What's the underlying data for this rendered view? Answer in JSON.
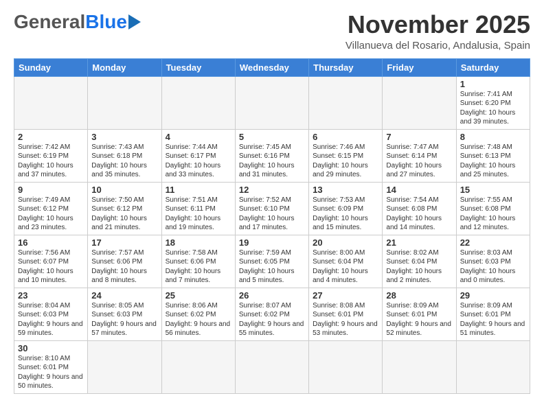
{
  "header": {
    "logo_general": "General",
    "logo_blue": "Blue",
    "month_title": "November 2025",
    "location": "Villanueva del Rosario, Andalusia, Spain"
  },
  "days_of_week": [
    "Sunday",
    "Monday",
    "Tuesday",
    "Wednesday",
    "Thursday",
    "Friday",
    "Saturday"
  ],
  "weeks": [
    [
      {
        "day": null,
        "info": null
      },
      {
        "day": null,
        "info": null
      },
      {
        "day": null,
        "info": null
      },
      {
        "day": null,
        "info": null
      },
      {
        "day": null,
        "info": null
      },
      {
        "day": null,
        "info": null
      },
      {
        "day": "1",
        "info": "Sunrise: 7:41 AM\nSunset: 6:20 PM\nDaylight: 10 hours and 39 minutes."
      }
    ],
    [
      {
        "day": "2",
        "info": "Sunrise: 7:42 AM\nSunset: 6:19 PM\nDaylight: 10 hours and 37 minutes."
      },
      {
        "day": "3",
        "info": "Sunrise: 7:43 AM\nSunset: 6:18 PM\nDaylight: 10 hours and 35 minutes."
      },
      {
        "day": "4",
        "info": "Sunrise: 7:44 AM\nSunset: 6:17 PM\nDaylight: 10 hours and 33 minutes."
      },
      {
        "day": "5",
        "info": "Sunrise: 7:45 AM\nSunset: 6:16 PM\nDaylight: 10 hours and 31 minutes."
      },
      {
        "day": "6",
        "info": "Sunrise: 7:46 AM\nSunset: 6:15 PM\nDaylight: 10 hours and 29 minutes."
      },
      {
        "day": "7",
        "info": "Sunrise: 7:47 AM\nSunset: 6:14 PM\nDaylight: 10 hours and 27 minutes."
      },
      {
        "day": "8",
        "info": "Sunrise: 7:48 AM\nSunset: 6:13 PM\nDaylight: 10 hours and 25 minutes."
      }
    ],
    [
      {
        "day": "9",
        "info": "Sunrise: 7:49 AM\nSunset: 6:12 PM\nDaylight: 10 hours and 23 minutes."
      },
      {
        "day": "10",
        "info": "Sunrise: 7:50 AM\nSunset: 6:12 PM\nDaylight: 10 hours and 21 minutes."
      },
      {
        "day": "11",
        "info": "Sunrise: 7:51 AM\nSunset: 6:11 PM\nDaylight: 10 hours and 19 minutes."
      },
      {
        "day": "12",
        "info": "Sunrise: 7:52 AM\nSunset: 6:10 PM\nDaylight: 10 hours and 17 minutes."
      },
      {
        "day": "13",
        "info": "Sunrise: 7:53 AM\nSunset: 6:09 PM\nDaylight: 10 hours and 15 minutes."
      },
      {
        "day": "14",
        "info": "Sunrise: 7:54 AM\nSunset: 6:08 PM\nDaylight: 10 hours and 14 minutes."
      },
      {
        "day": "15",
        "info": "Sunrise: 7:55 AM\nSunset: 6:08 PM\nDaylight: 10 hours and 12 minutes."
      }
    ],
    [
      {
        "day": "16",
        "info": "Sunrise: 7:56 AM\nSunset: 6:07 PM\nDaylight: 10 hours and 10 minutes."
      },
      {
        "day": "17",
        "info": "Sunrise: 7:57 AM\nSunset: 6:06 PM\nDaylight: 10 hours and 8 minutes."
      },
      {
        "day": "18",
        "info": "Sunrise: 7:58 AM\nSunset: 6:06 PM\nDaylight: 10 hours and 7 minutes."
      },
      {
        "day": "19",
        "info": "Sunrise: 7:59 AM\nSunset: 6:05 PM\nDaylight: 10 hours and 5 minutes."
      },
      {
        "day": "20",
        "info": "Sunrise: 8:00 AM\nSunset: 6:04 PM\nDaylight: 10 hours and 4 minutes."
      },
      {
        "day": "21",
        "info": "Sunrise: 8:02 AM\nSunset: 6:04 PM\nDaylight: 10 hours and 2 minutes."
      },
      {
        "day": "22",
        "info": "Sunrise: 8:03 AM\nSunset: 6:03 PM\nDaylight: 10 hours and 0 minutes."
      }
    ],
    [
      {
        "day": "23",
        "info": "Sunrise: 8:04 AM\nSunset: 6:03 PM\nDaylight: 9 hours and 59 minutes."
      },
      {
        "day": "24",
        "info": "Sunrise: 8:05 AM\nSunset: 6:03 PM\nDaylight: 9 hours and 57 minutes."
      },
      {
        "day": "25",
        "info": "Sunrise: 8:06 AM\nSunset: 6:02 PM\nDaylight: 9 hours and 56 minutes."
      },
      {
        "day": "26",
        "info": "Sunrise: 8:07 AM\nSunset: 6:02 PM\nDaylight: 9 hours and 55 minutes."
      },
      {
        "day": "27",
        "info": "Sunrise: 8:08 AM\nSunset: 6:01 PM\nDaylight: 9 hours and 53 minutes."
      },
      {
        "day": "28",
        "info": "Sunrise: 8:09 AM\nSunset: 6:01 PM\nDaylight: 9 hours and 52 minutes."
      },
      {
        "day": "29",
        "info": "Sunrise: 8:09 AM\nSunset: 6:01 PM\nDaylight: 9 hours and 51 minutes."
      }
    ],
    [
      {
        "day": "30",
        "info": "Sunrise: 8:10 AM\nSunset: 6:01 PM\nDaylight: 9 hours and 50 minutes."
      },
      {
        "day": null,
        "info": null
      },
      {
        "day": null,
        "info": null
      },
      {
        "day": null,
        "info": null
      },
      {
        "day": null,
        "info": null
      },
      {
        "day": null,
        "info": null
      },
      {
        "day": null,
        "info": null
      }
    ]
  ]
}
